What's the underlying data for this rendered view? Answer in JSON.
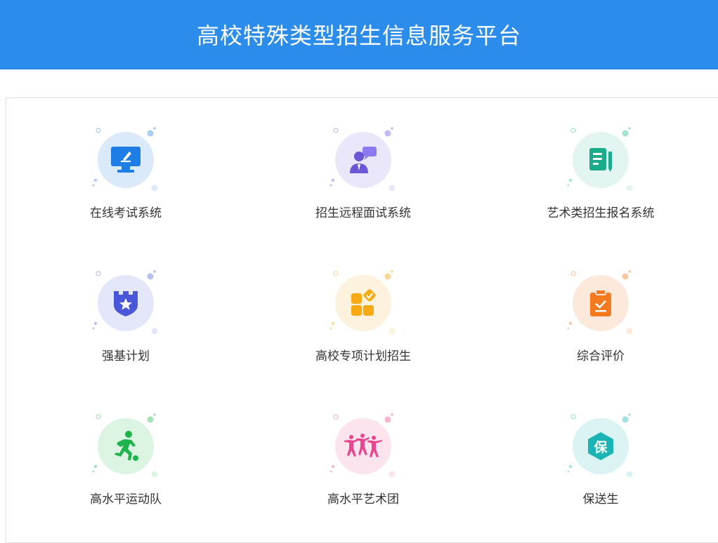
{
  "header": {
    "title": "高校特殊类型招生信息服务平台"
  },
  "colors": {
    "header_bg": "#2b8ceb"
  },
  "services": [
    {
      "label": "在线考试系统",
      "icon": "monitor-pen-icon",
      "bg": "#dbeafb",
      "fg": "#1f7ee6",
      "dot": "#a9ccf4"
    },
    {
      "label": "招生远程面试系统",
      "icon": "interview-person-icon",
      "bg": "#ebe7fb",
      "fg": "#6a57d6",
      "dot": "#c3b9f1"
    },
    {
      "label": "艺术类招生报名系统",
      "icon": "document-pen-icon",
      "bg": "#e2f5f0",
      "fg": "#1aab8a",
      "dot": "#a6e2d2"
    },
    {
      "label": "强基计划",
      "icon": "castle-star-icon",
      "bg": "#e4e6fa",
      "fg": "#4a56d8",
      "dot": "#b9bff0"
    },
    {
      "label": "高校专项计划招生",
      "icon": "blocks-check-icon",
      "bg": "#fdf2dd",
      "fg": "#f7aa14",
      "dot": "#f8d99c"
    },
    {
      "label": "综合评价",
      "icon": "clipboard-check-icon",
      "bg": "#fde9dc",
      "fg": "#f57a1f",
      "dot": "#f8c7a3"
    },
    {
      "label": "高水平运动队",
      "icon": "soccer-player-icon",
      "bg": "#dcf5e3",
      "fg": "#1fb44b",
      "dot": "#a3e2b5"
    },
    {
      "label": "高水平艺术团",
      "icon": "dancers-icon",
      "bg": "#fce4ef",
      "fg": "#e8478f",
      "dot": "#f5b4d0"
    },
    {
      "label": "保送生",
      "icon": "hexagon-bao-icon",
      "bg": "#dcf3f3",
      "fg": "#1bb4b4",
      "dot": "#a3e0e0",
      "glyph": "保"
    }
  ]
}
